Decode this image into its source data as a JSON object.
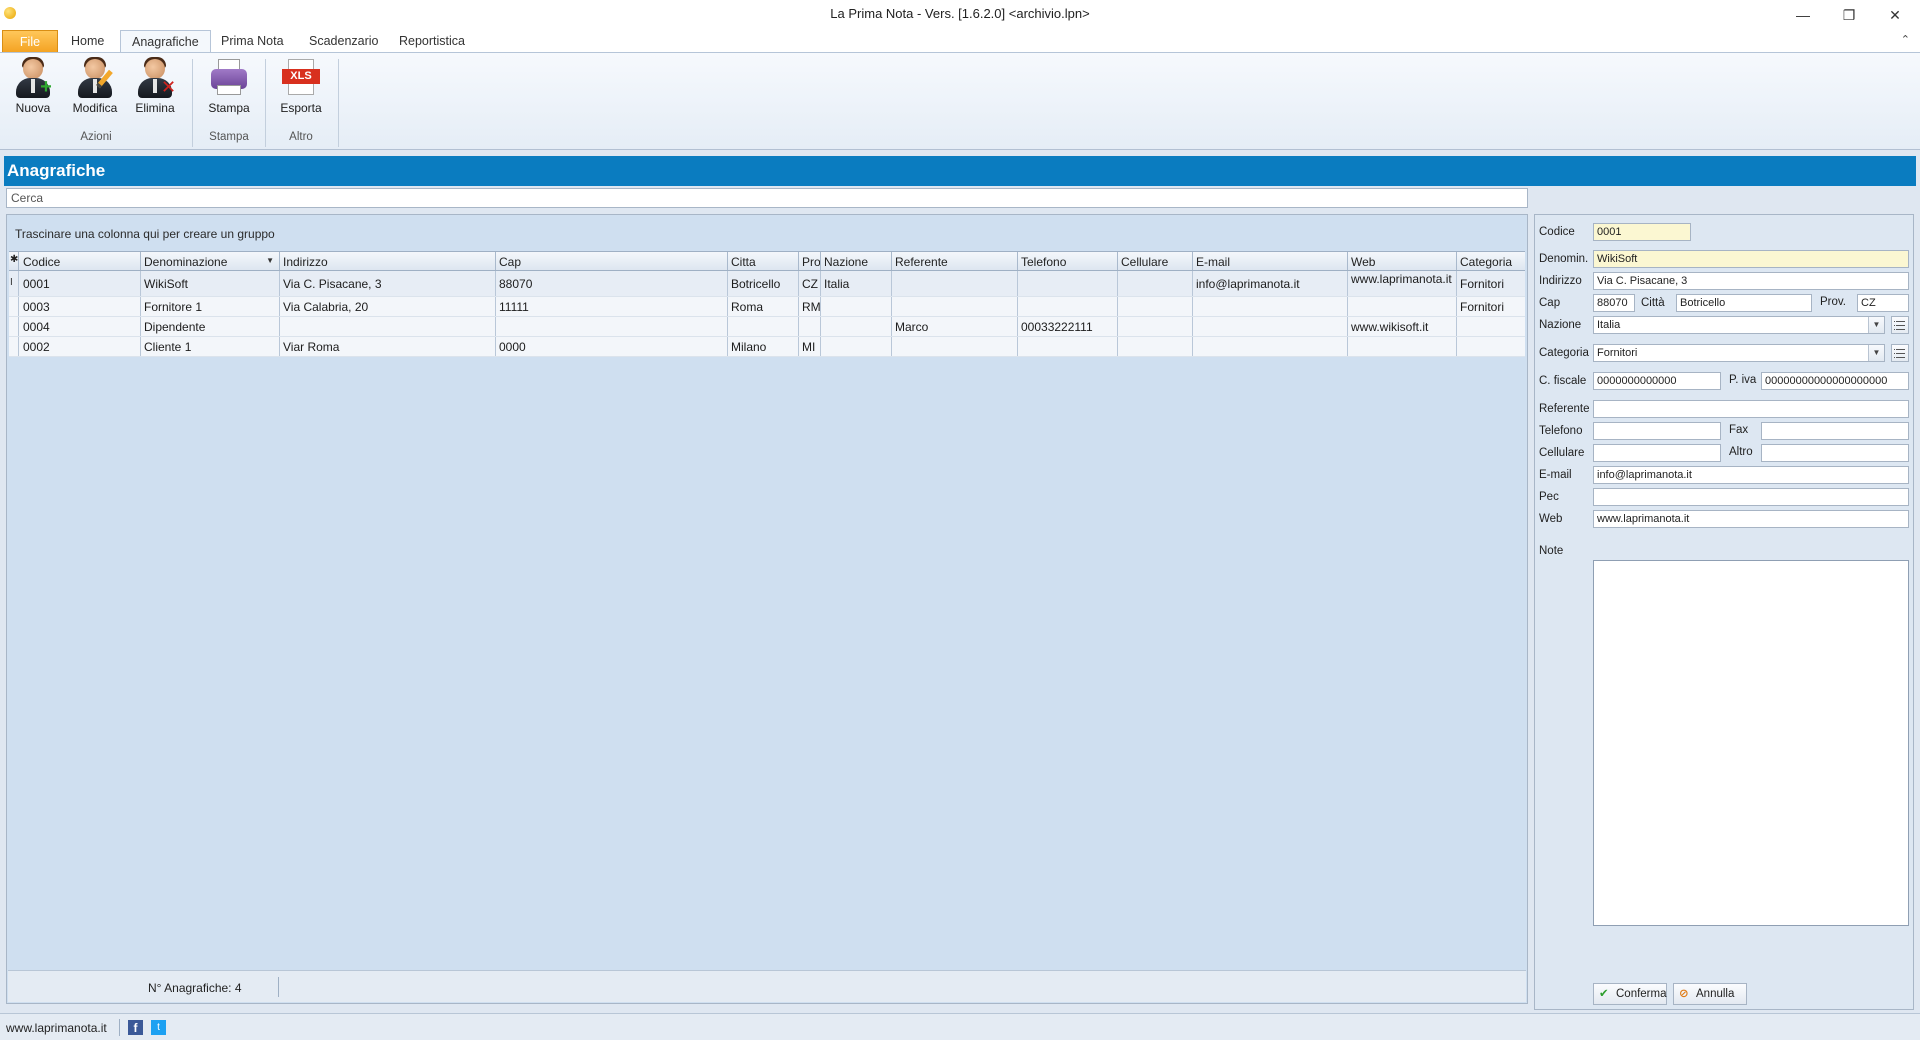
{
  "window": {
    "title": "La Prima Nota - Vers. [1.6.2.0] <archivio.lpn>",
    "minimize": "—",
    "restore": "❐",
    "close": "✕"
  },
  "ribbon": {
    "tabs": [
      "File",
      "Home",
      "Anagrafiche",
      "Prima Nota",
      "Scadenzario",
      "Reportistica"
    ],
    "buttons": {
      "nuova": "Nuova",
      "modifica": "Modifica",
      "elimina": "Elimina",
      "stampa": "Stampa",
      "esporta": "Esporta",
      "xls": "XLS"
    },
    "groups": {
      "azioni": "Azioni",
      "stampa": "Stampa",
      "altro": "Altro"
    }
  },
  "page": {
    "title": "Anagrafiche",
    "search_value": "Cerca"
  },
  "grid": {
    "group_hint": "Trascinare una colonna qui per creare un gruppo",
    "new_row_marker": "✱",
    "current_row_marker": "I",
    "columns": [
      "Codice",
      "Denominazione",
      "Indirizzo",
      "Cap",
      "Citta",
      "Pro",
      "Nazione",
      "Referente",
      "Telefono",
      "Cellulare",
      "E-mail",
      "Web",
      "Categoria"
    ],
    "rows": [
      {
        "codice": "0001",
        "denominazione": "WikiSoft",
        "indirizzo": "Via C. Pisacane, 3",
        "cap": "88070",
        "citta": "Botricello",
        "pro": "CZ",
        "nazione": "Italia",
        "referente": "",
        "telefono": "",
        "cellulare": "",
        "email": "info@laprimanota.it",
        "web": "www.laprimanota.it",
        "categoria": "Fornitori"
      },
      {
        "codice": "0003",
        "denominazione": "Fornitore 1",
        "indirizzo": "Via Calabria, 20",
        "cap": "11111",
        "citta": "Roma",
        "pro": "RM",
        "nazione": "",
        "referente": "",
        "telefono": "",
        "cellulare": "",
        "email": "",
        "web": "",
        "categoria": "Fornitori"
      },
      {
        "codice": "0004",
        "denominazione": "Dipendente",
        "indirizzo": "",
        "cap": "",
        "citta": "",
        "pro": "",
        "nazione": "",
        "referente": "Marco",
        "telefono": "00033222111",
        "cellulare": "",
        "email": "",
        "web": "www.wikisoft.it",
        "categoria": ""
      },
      {
        "codice": "0002",
        "denominazione": "Cliente 1",
        "indirizzo": "Viar Roma",
        "cap": "0000",
        "citta": "Milano",
        "pro": "MI",
        "nazione": "",
        "referente": "",
        "telefono": "",
        "cellulare": "",
        "email": "",
        "web": "",
        "categoria": ""
      }
    ],
    "count_label": "N° Anagrafiche: 4"
  },
  "detail": {
    "labels": {
      "codice": "Codice",
      "denomin": "Denomin.",
      "indirizzo": "Indirizzo",
      "cap": "Cap",
      "citta": "Città",
      "prov": "Prov.",
      "nazione": "Nazione",
      "categoria": "Categoria",
      "cfiscale": "C. fiscale",
      "piva": "P. iva",
      "referente": "Referente",
      "telefono": "Telefono",
      "fax": "Fax",
      "cellulare": "Cellulare",
      "altro": "Altro",
      "email": "E-mail",
      "pec": "Pec",
      "web": "Web",
      "note": "Note"
    },
    "values": {
      "codice": "0001",
      "denomin": "WikiSoft",
      "indirizzo": "Via C. Pisacane, 3",
      "cap": "88070",
      "citta": "Botricello",
      "prov": "CZ",
      "nazione": "Italia",
      "categoria": "Fornitori",
      "cfiscale": "0000000000000",
      "piva": "00000000000000000000",
      "referente": "",
      "telefono": "",
      "fax": "",
      "cellulare": "",
      "altro": "",
      "email": "info@laprimanota.it",
      "pec": "",
      "web": "www.laprimanota.it",
      "note": ""
    },
    "buttons": {
      "conferma": "Conferma",
      "annulla": "Annulla"
    }
  },
  "footer": {
    "site": "www.laprimanota.it",
    "facebook": "f",
    "twitter": "t"
  },
  "colors": {
    "header_band": "#0a7cc0",
    "file_tab": "#f4a323",
    "panel_bg": "#cfdff0"
  }
}
